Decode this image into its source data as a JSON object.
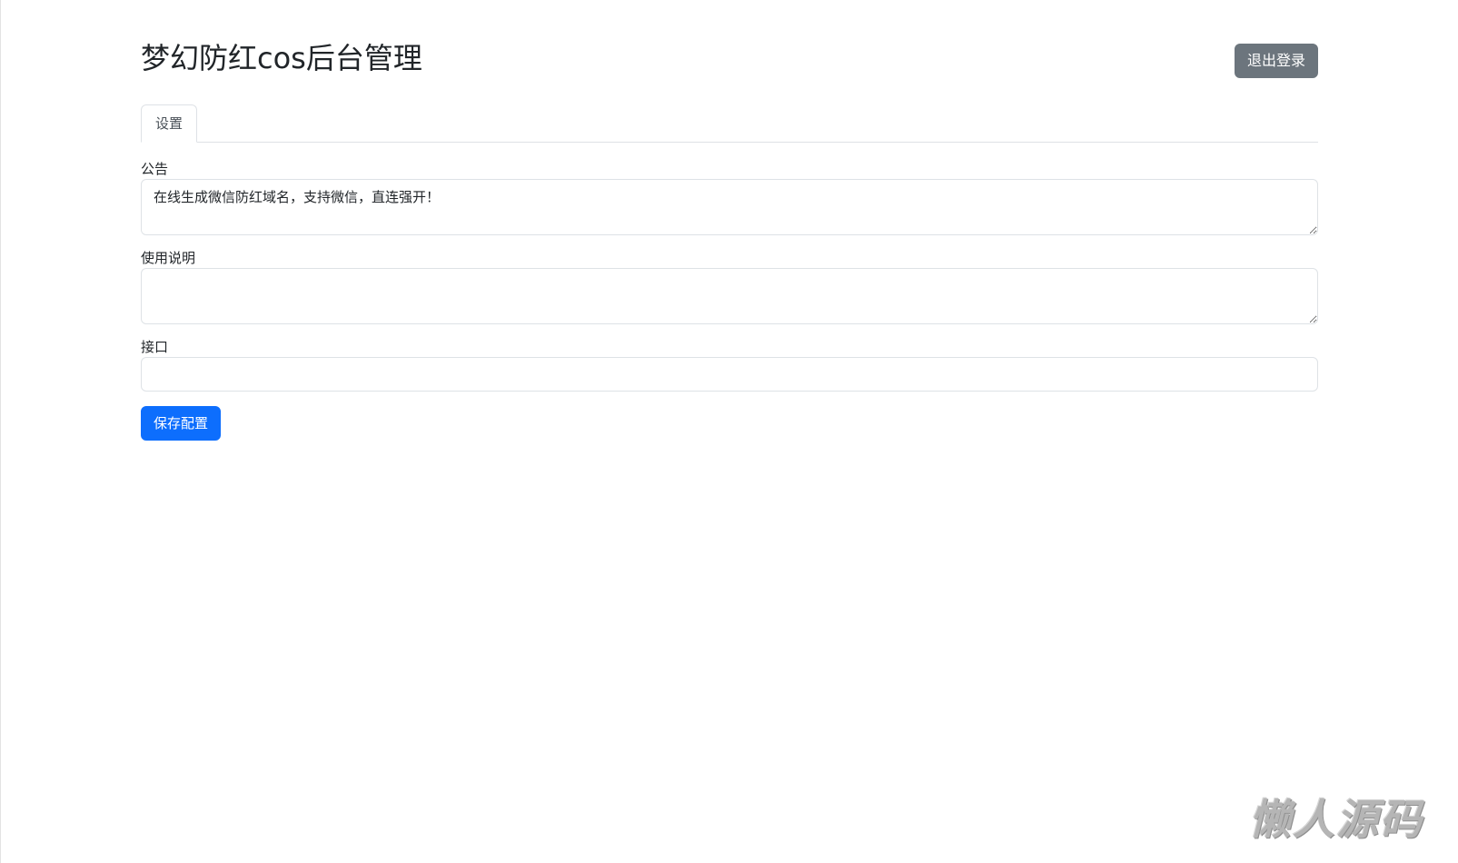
{
  "header": {
    "title": "梦幻防红cos后台管理",
    "logout_label": "退出登录"
  },
  "tabs": [
    {
      "label": "设置",
      "active": true
    }
  ],
  "form": {
    "announcement": {
      "label": "公告",
      "value": "在线生成微信防红域名，支持微信，直连强开！"
    },
    "instructions": {
      "label": "使用说明",
      "value": ""
    },
    "api": {
      "label": "接口",
      "value": ""
    },
    "save_label": "保存配置"
  },
  "watermark": {
    "text": "懒人源码"
  },
  "colors": {
    "primary": "#0d6efd",
    "secondary": "#6c757d",
    "border": "#dee2e6",
    "text": "#212529"
  }
}
